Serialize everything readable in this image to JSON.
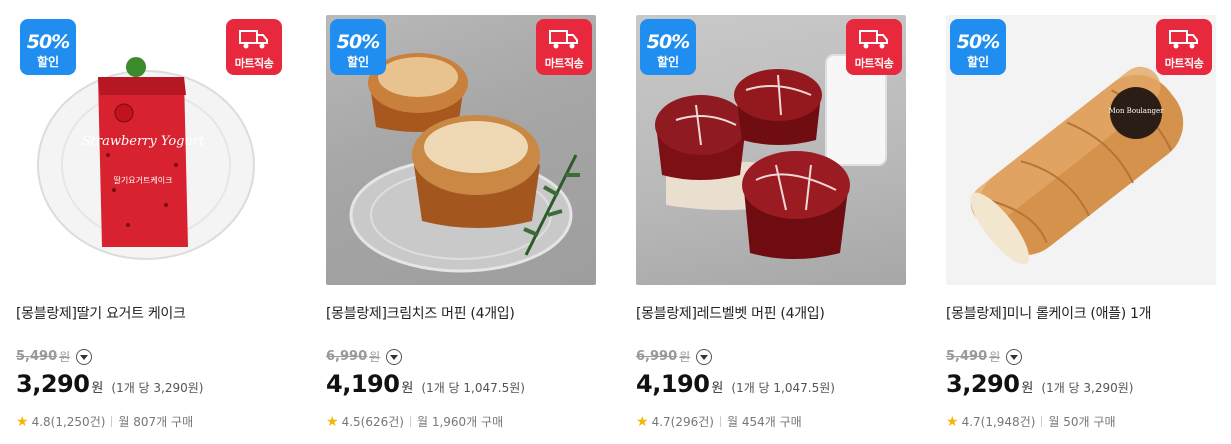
{
  "badges": {
    "sale_small": "tear",
    "sale_percent": "50%",
    "sale_label": "할인",
    "mart_label": "마트직송",
    "mart_icon": "truck-icon"
  },
  "colors": {
    "sale_badge": "#1f8ef0",
    "mart_badge": "#e8283c",
    "star": "#f2b705"
  },
  "products": [
    {
      "title": "[몽블랑제]딸기 요거트 케이크",
      "original_price": "5,490",
      "original_won": "원",
      "price": "3,290",
      "price_won": "원",
      "unit_price": "(1개 당 3,290원)",
      "rating": "4.8",
      "reviews": "(1,250건)",
      "monthly": "월 807개 구매",
      "image_text": {
        "brand": "Strawberry Yogurt",
        "name": "딸기요거트케이크"
      }
    },
    {
      "title": "[몽블랑제]크림치즈 머핀 (4개입)",
      "original_price": "6,990",
      "original_won": "원",
      "price": "4,190",
      "price_won": "원",
      "unit_price": "(1개 당 1,047.5원)",
      "rating": "4.5",
      "reviews": "(626건)",
      "monthly": "월 1,960개 구매"
    },
    {
      "title": "[몽블랑제]레드벨벳 머핀 (4개입)",
      "original_price": "6,990",
      "original_won": "원",
      "price": "4,190",
      "price_won": "원",
      "unit_price": "(1개 당 1,047.5원)",
      "rating": "4.7",
      "reviews": "(296건)",
      "monthly": "월 454개 구매"
    },
    {
      "title": "[몽블랑제]미니 롤케이크 (애플) 1개",
      "original_price": "5,490",
      "original_won": "원",
      "price": "3,290",
      "price_won": "원",
      "unit_price": "(1개 당 3,290원)",
      "rating": "4.7",
      "reviews": "(1,948건)",
      "monthly": "월 50개 구매",
      "image_text": {
        "sticker": "Mon Boulanger"
      }
    }
  ]
}
